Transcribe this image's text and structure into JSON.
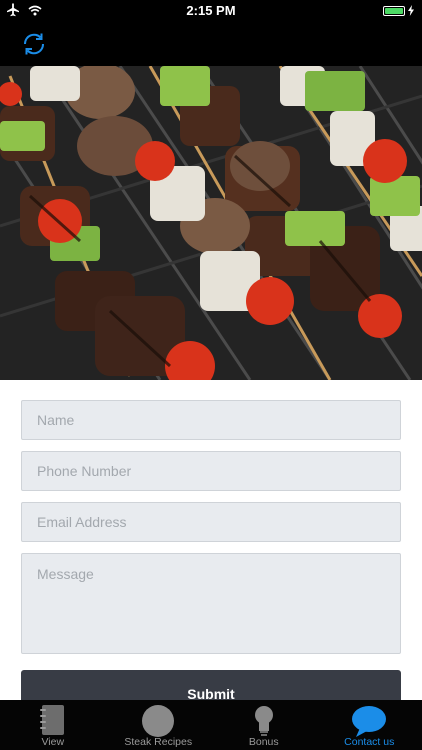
{
  "status_bar": {
    "time": "2:15 PM"
  },
  "nav": {
    "refresh_icon": "refresh-icon"
  },
  "hero": {
    "icon": "grilled-kebab-photo"
  },
  "form": {
    "name_placeholder": "Name",
    "phone_placeholder": "Phone Number",
    "email_placeholder": "Email Address",
    "message_placeholder": "Message",
    "submit_label": "Submit"
  },
  "tabs": [
    {
      "label": "View",
      "icon": "notebook-icon",
      "active": false
    },
    {
      "label": "Steak Recipes",
      "icon": "circle-icon",
      "active": false
    },
    {
      "label": "Bonus",
      "icon": "lightbulb-icon",
      "active": false
    },
    {
      "label": "Contact us",
      "icon": "chat-bubble-icon",
      "active": true
    }
  ],
  "colors": {
    "accent": "#1b8de8",
    "submit_bg": "#383c45",
    "field_bg": "#e8ebef",
    "tab_bar_bg": "#050505"
  }
}
